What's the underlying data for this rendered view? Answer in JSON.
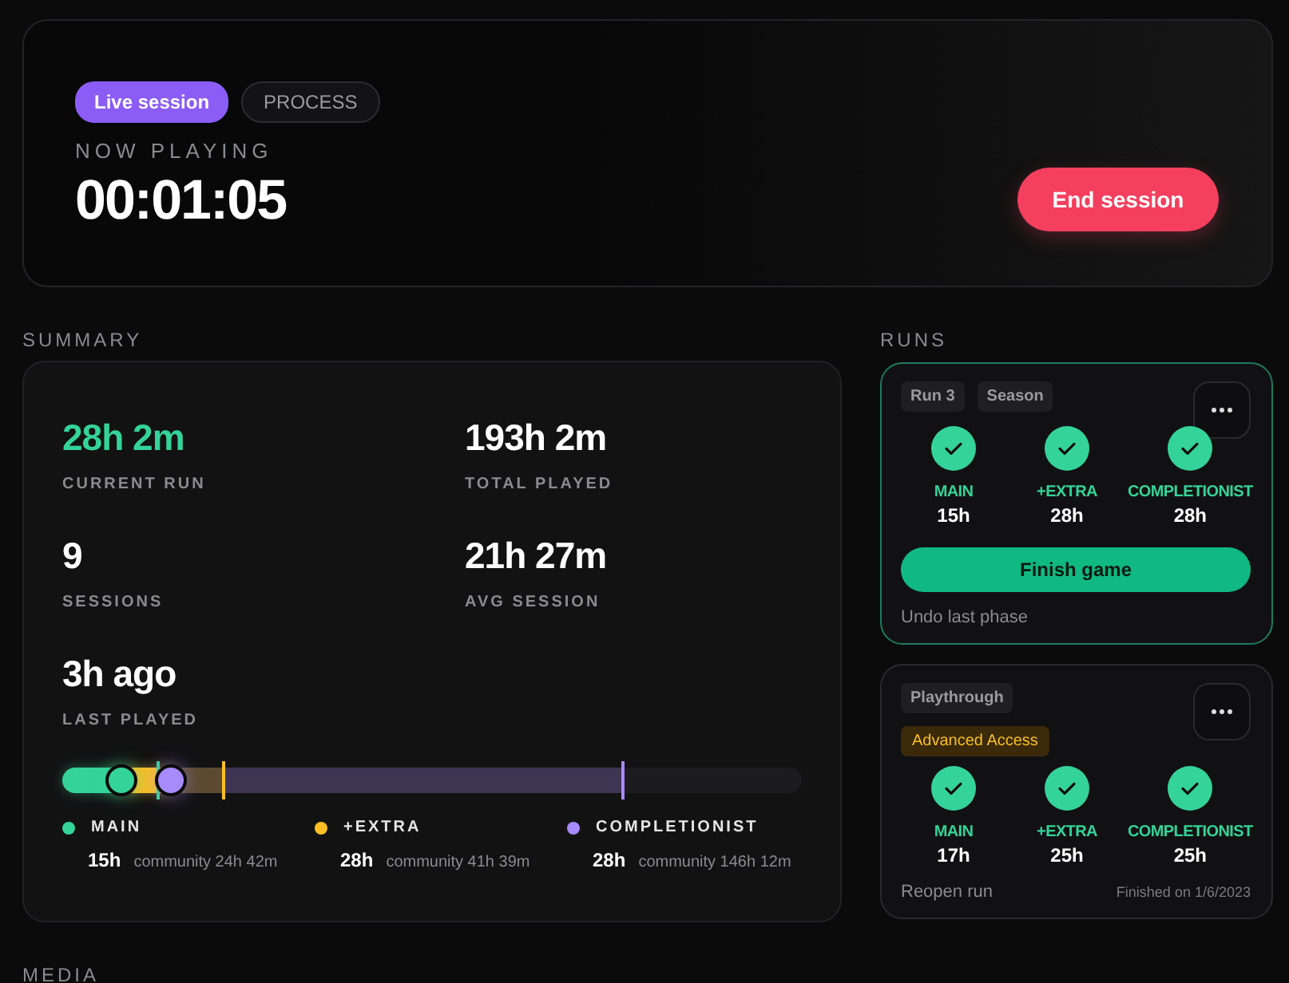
{
  "session": {
    "live_badge": "Live session",
    "process_badge": "PROCESS",
    "label": "NOW PLAYING",
    "timer": "00:01:05",
    "end_button": "End session"
  },
  "summary": {
    "heading": "SUMMARY",
    "stats": [
      {
        "value": "28h 2m",
        "label": "CURRENT RUN",
        "highlight": true
      },
      {
        "value": "193h 2m",
        "label": "TOTAL PLAYED",
        "highlight": false
      },
      {
        "value": "9",
        "label": "SESSIONS",
        "highlight": false
      },
      {
        "value": "21h 27m",
        "label": "AVG SESSION",
        "highlight": false
      },
      {
        "value": "3h ago",
        "label": "LAST PLAYED",
        "highlight": false
      }
    ],
    "progress_bar": {
      "segments": [
        {
          "kind": "fill",
          "color": "#34d399"
        },
        {
          "kind": "fill",
          "color": "#fbbf24"
        },
        {
          "kind": "range",
          "color": "#5c4a30"
        },
        {
          "kind": "range",
          "color": "#3e3552"
        }
      ],
      "markers": [
        {
          "color": "#34d399",
          "level": 0.128
        },
        {
          "color": "#fbbf24",
          "level": 0.216
        },
        {
          "color": "#a78bfa",
          "level": 0.756
        }
      ],
      "dots": [
        {
          "color": "#34d399",
          "level": 0.078
        },
        {
          "color": "#a78bfa",
          "level": 0.145
        }
      ]
    },
    "legend": [
      {
        "name": "MAIN",
        "color": "#34d399",
        "time": "15h",
        "community": "community 24h 42m"
      },
      {
        "name": "+EXTRA",
        "color": "#fbbf24",
        "time": "28h",
        "community": "community 41h 39m"
      },
      {
        "name": "COMPLETIONIST",
        "color": "#a78bfa",
        "time": "28h",
        "community": "community 146h 12m"
      }
    ]
  },
  "runs": {
    "heading": "RUNS",
    "items": [
      {
        "selected": true,
        "tags": [
          "Run 3",
          "Season"
        ],
        "phases": [
          {
            "name": "MAIN",
            "time": "15h",
            "done": true
          },
          {
            "name": "+EXTRA",
            "time": "28h",
            "done": true
          },
          {
            "name": "COMPLETIONIST",
            "time": "28h",
            "done": true
          }
        ],
        "primary_button": "Finish game",
        "link": "Undo last phase"
      },
      {
        "selected": false,
        "tags": [
          "Playthrough"
        ],
        "badge": "Advanced Access",
        "phases": [
          {
            "name": "MAIN",
            "time": "17h",
            "done": true
          },
          {
            "name": "+EXTRA",
            "time": "25h",
            "done": true
          },
          {
            "name": "COMPLETIONIST",
            "time": "25h",
            "done": true
          }
        ],
        "link": "Reopen run",
        "note": "Finished on 1/6/2023"
      }
    ]
  },
  "media": {
    "heading": "MEDIA"
  }
}
